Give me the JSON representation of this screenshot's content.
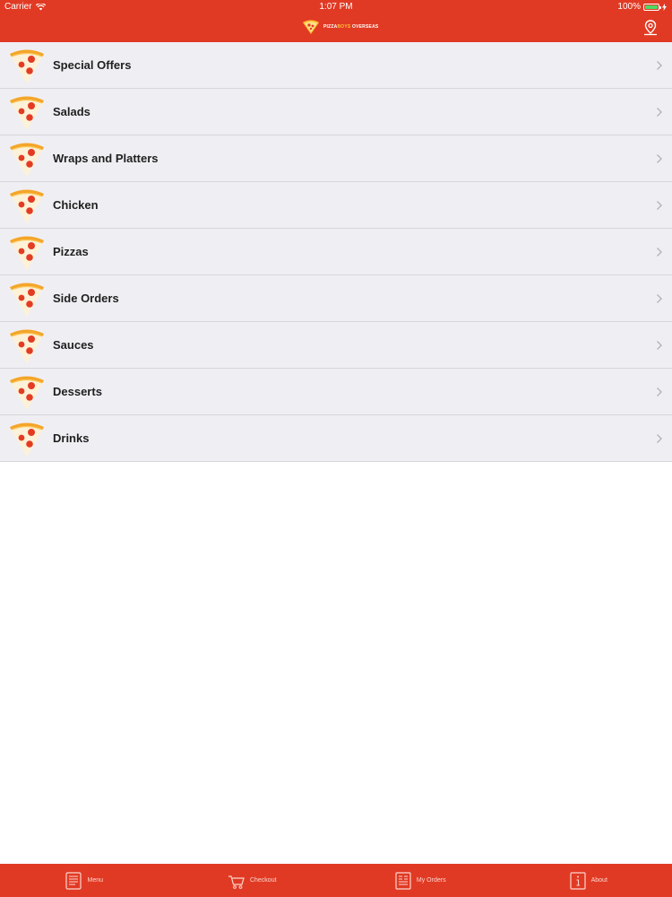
{
  "status_bar": {
    "carrier": "Carrier",
    "time": "1:07 PM",
    "battery": "100%"
  },
  "header": {
    "logo_main": "PIZZA",
    "logo_accent": "BOYS",
    "logo_rest": " OVERSEAS"
  },
  "menu": {
    "items": [
      {
        "label": "Special Offers"
      },
      {
        "label": "Salads"
      },
      {
        "label": "Wraps and Platters"
      },
      {
        "label": "Chicken"
      },
      {
        "label": "Pizzas"
      },
      {
        "label": "Side Orders"
      },
      {
        "label": "Sauces"
      },
      {
        "label": "Desserts"
      },
      {
        "label": "Drinks"
      }
    ]
  },
  "tabs": [
    {
      "label": "Menu",
      "icon": "menu-icon"
    },
    {
      "label": "Checkout",
      "icon": "cart-icon"
    },
    {
      "label": "My Orders",
      "icon": "receipt-icon"
    },
    {
      "label": "About",
      "icon": "info-icon"
    }
  ],
  "colors": {
    "brand_red": "#e13a24",
    "row_bg": "#efeff3",
    "battery_green": "#4cd964"
  }
}
